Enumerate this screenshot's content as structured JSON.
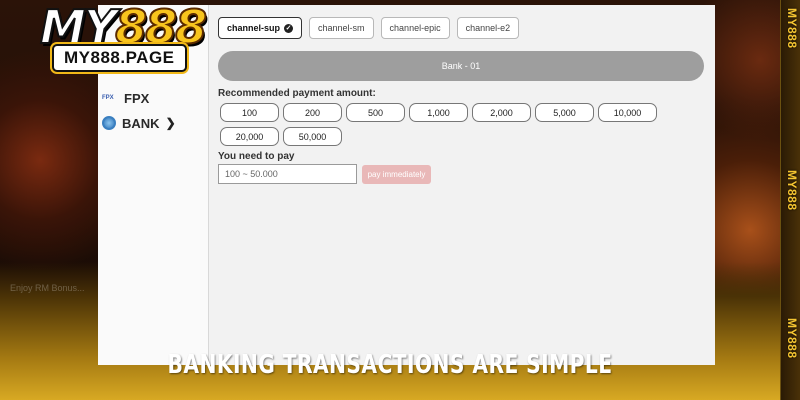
{
  "brand": {
    "logo_my": "MY",
    "logo_888": "888",
    "logo_domain": "MY888.PAGE",
    "side_logo": "MY888",
    "gold": "#f8c41d"
  },
  "sidebar": {
    "items": [
      {
        "label": "FPX",
        "icon": "fpx-logo-icon"
      },
      {
        "label": "BANK",
        "icon": "globe-icon"
      }
    ]
  },
  "channels": {
    "tabs": [
      {
        "label": "channel-sup",
        "active": true
      },
      {
        "label": "channel-sm",
        "active": false
      },
      {
        "label": "channel-epic",
        "active": false
      },
      {
        "label": "channel-e2",
        "active": false
      }
    ]
  },
  "bank": {
    "selected": "Bank - 01"
  },
  "payment": {
    "recommended_label": "Recommended payment amount:",
    "amounts": [
      "100",
      "200",
      "500",
      "1,000",
      "2,000",
      "5,000",
      "10,000",
      "20,000",
      "50,000"
    ],
    "pay_label": "You need to pay",
    "input_placeholder": "100 ~ 50.000",
    "pay_button": "pay immediately"
  },
  "ticker": "Enjoy RM Bonus...",
  "caption": "BANKING TRANSACTIONS ARE SIMPLE"
}
